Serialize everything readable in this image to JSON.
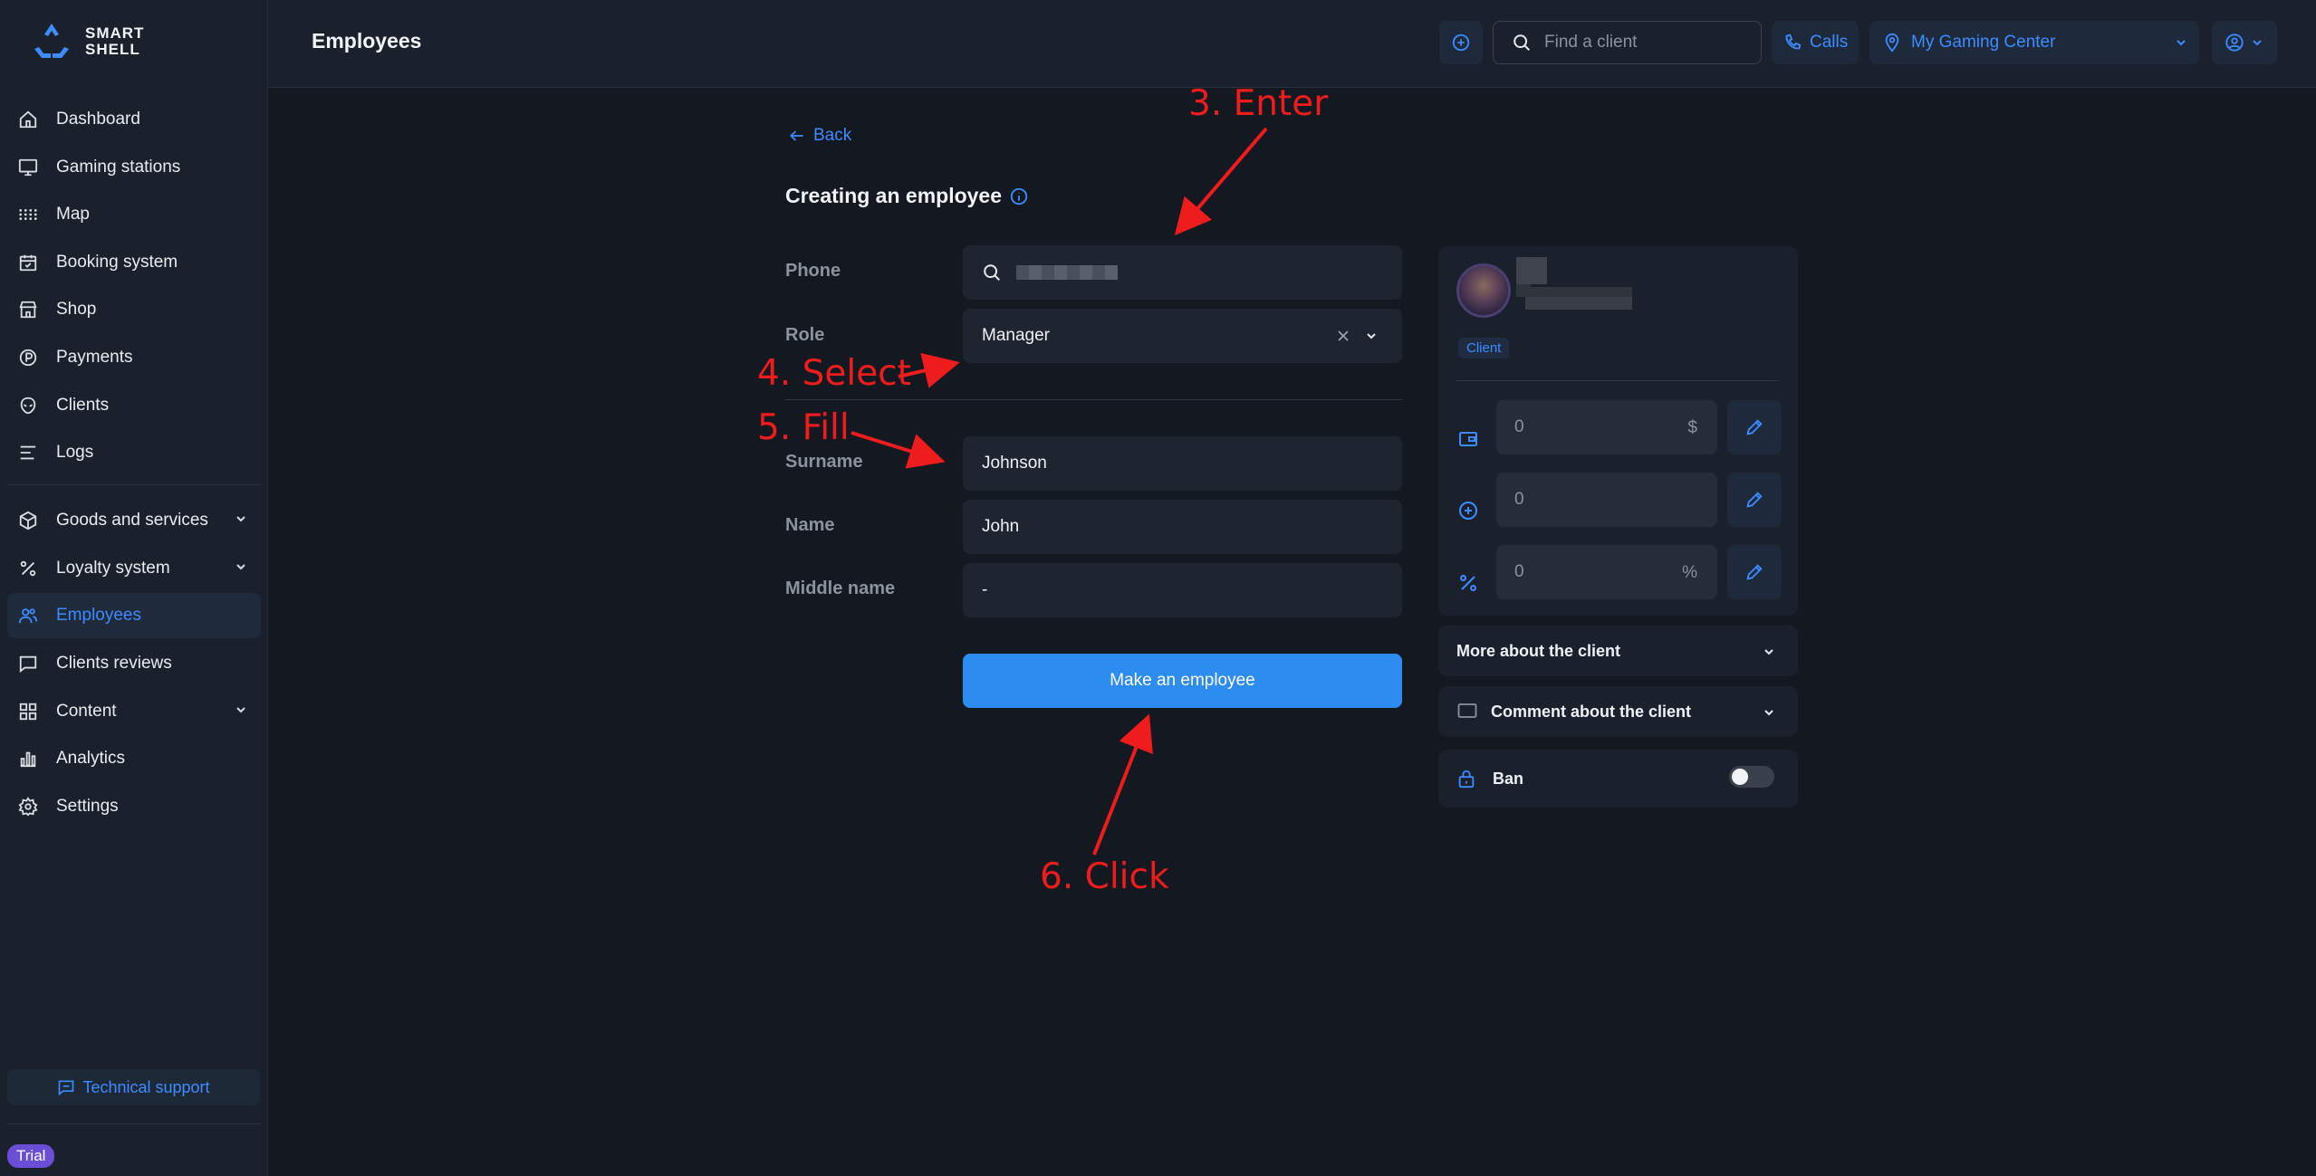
{
  "app": {
    "logo_line1": "SMART",
    "logo_line2": "SHELL"
  },
  "header": {
    "title": "Employees",
    "search_placeholder": "Find a client",
    "calls_label": "Calls",
    "location_label": "My Gaming Center"
  },
  "sidebar": {
    "items": [
      {
        "label": "Dashboard",
        "icon": "home-icon"
      },
      {
        "label": "Gaming stations",
        "icon": "monitor-icon"
      },
      {
        "label": "Map",
        "icon": "grid-dots-icon"
      },
      {
        "label": "Booking system",
        "icon": "calendar-icon"
      },
      {
        "label": "Shop",
        "icon": "store-icon"
      },
      {
        "label": "Payments",
        "icon": "coin-icon"
      },
      {
        "label": "Clients",
        "icon": "alien-icon"
      },
      {
        "label": "Logs",
        "icon": "lines-icon"
      },
      {
        "label": "Goods and services",
        "icon": "box-icon"
      },
      {
        "label": "Loyalty system",
        "icon": "percent-icon"
      },
      {
        "label": "Employees",
        "icon": "users-icon"
      },
      {
        "label": "Clients reviews",
        "icon": "chat-icon"
      },
      {
        "label": "Content",
        "icon": "tiles-icon"
      },
      {
        "label": "Analytics",
        "icon": "bars-icon"
      },
      {
        "label": "Settings",
        "icon": "gear-icon"
      }
    ],
    "support_label": "Technical support",
    "trial_label": "Trial"
  },
  "form": {
    "back_label": "Back",
    "title": "Creating an employee",
    "phone_label": "Phone",
    "role_label": "Role",
    "role_value": "Manager",
    "surname_label": "Surname",
    "surname_value": "Johnson",
    "name_label": "Name",
    "name_value": "John",
    "middle_label": "Middle name",
    "middle_value": "-",
    "submit_label": "Make an employee"
  },
  "client_card": {
    "tag": "Client",
    "balance": "0",
    "balance_suffix": "$",
    "bonus": "0",
    "discount": "0",
    "discount_suffix": "%",
    "more_label": "More about the client",
    "comment_label": "Comment about the client",
    "ban_label": "Ban"
  },
  "annotations": {
    "step3": "3. Enter",
    "step4": "4. Select",
    "step5": "5. Fill",
    "step6": "6. Click"
  },
  "colors": {
    "accent": "#3d8bff",
    "primary_button": "#2d8cf0",
    "annotation": "#ee1c1c",
    "trial_badge": "#6a4fd6"
  }
}
